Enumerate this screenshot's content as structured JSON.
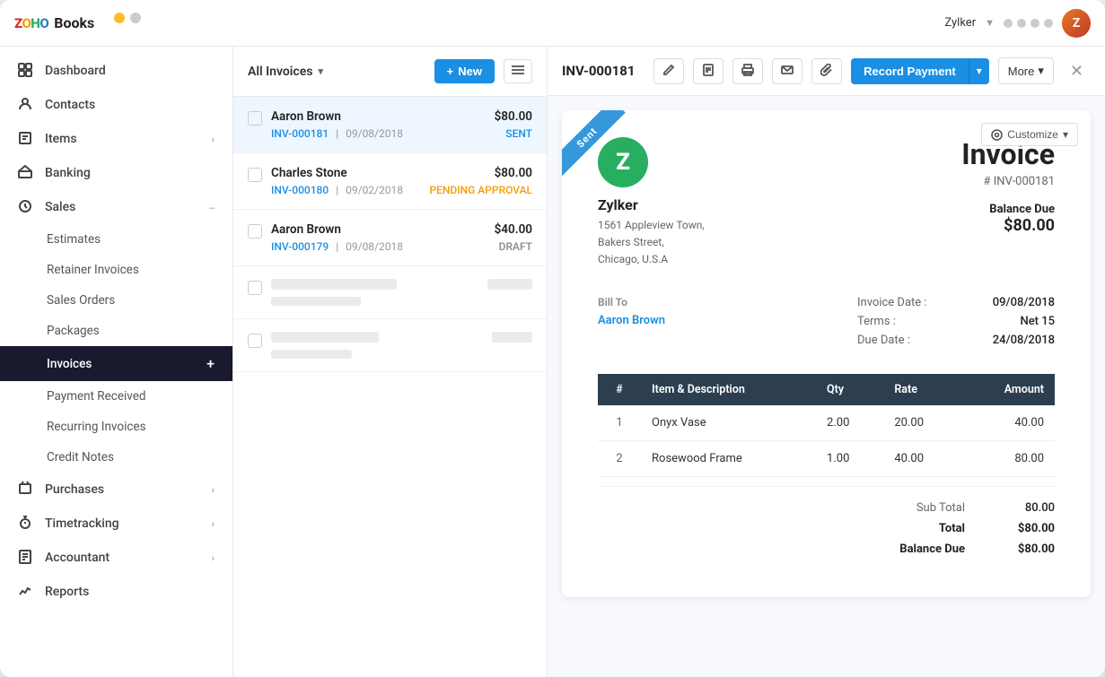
{
  "app": {
    "name": "Books",
    "brand": "ZOHO",
    "user": "Zylker",
    "user_avatar_text": "Z"
  },
  "sidebar": {
    "items": [
      {
        "id": "dashboard",
        "label": "Dashboard",
        "icon": "dashboard-icon",
        "has_children": false
      },
      {
        "id": "contacts",
        "label": "Contacts",
        "icon": "contacts-icon",
        "has_children": false
      },
      {
        "id": "items",
        "label": "Items",
        "icon": "items-icon",
        "has_children": true
      },
      {
        "id": "banking",
        "label": "Banking",
        "icon": "banking-icon",
        "has_children": false
      },
      {
        "id": "sales",
        "label": "Sales",
        "icon": "sales-icon",
        "has_children": true,
        "expanded": true
      }
    ],
    "sales_sub_items": [
      {
        "id": "estimates",
        "label": "Estimates"
      },
      {
        "id": "retainer-invoices",
        "label": "Retainer Invoices"
      },
      {
        "id": "sales-orders",
        "label": "Sales Orders"
      },
      {
        "id": "packages",
        "label": "Packages"
      },
      {
        "id": "invoices",
        "label": "Invoices",
        "active": true
      },
      {
        "id": "payment-received",
        "label": "Payment Received"
      },
      {
        "id": "recurring-invoices",
        "label": "Recurring Invoices"
      },
      {
        "id": "credit-notes",
        "label": "Credit Notes"
      }
    ],
    "bottom_items": [
      {
        "id": "purchases",
        "label": "Purchases",
        "icon": "purchases-icon",
        "has_children": true
      },
      {
        "id": "timetracking",
        "label": "Timetracking",
        "icon": "timetracking-icon",
        "has_children": true
      },
      {
        "id": "accountant",
        "label": "Accountant",
        "icon": "accountant-icon",
        "has_children": true
      },
      {
        "id": "reports",
        "label": "Reports",
        "icon": "reports-icon",
        "has_children": false
      }
    ]
  },
  "invoice_list": {
    "filter_label": "All Invoices",
    "new_button": "New",
    "invoices": [
      {
        "id": "inv1",
        "customer": "Aaron Brown",
        "number": "INV-000181",
        "date": "09/08/2018",
        "amount": "$80.00",
        "status": "SENT",
        "status_class": "status-sent",
        "selected": true
      },
      {
        "id": "inv2",
        "customer": "Charles Stone",
        "number": "INV-000180",
        "date": "09/02/2018",
        "amount": "$80.00",
        "status": "PENDING APPROVAL",
        "status_class": "status-pending",
        "selected": false
      },
      {
        "id": "inv3",
        "customer": "Aaron Brown",
        "number": "INV-000179",
        "date": "09/08/2018",
        "amount": "$40.00",
        "status": "DRAFT",
        "status_class": "status-draft",
        "selected": false
      }
    ]
  },
  "invoice_detail": {
    "invoice_id": "INV-000181",
    "record_payment_label": "Record Payment",
    "more_label": "More",
    "sent_ribbon": "Sent",
    "customize_label": "Customize",
    "company": {
      "name": "Zylker",
      "address_line1": "1561 Appleview Town,",
      "address_line2": "Bakers Street,",
      "address_line3": "Chicago, U.S.A",
      "logo_letter": "Z"
    },
    "invoice_title": "Invoice",
    "invoice_number": "# INV-000181",
    "balance_due_label": "Balance Due",
    "balance_due_amount": "$80.00",
    "bill_to_label": "Bill To",
    "bill_to_name": "Aaron Brown",
    "meta": {
      "invoice_date_label": "Invoice Date :",
      "invoice_date_value": "09/08/2018",
      "terms_label": "Terms :",
      "terms_value": "Net 15",
      "due_date_label": "Due Date :",
      "due_date_value": "24/08/2018"
    },
    "table": {
      "headers": [
        "#",
        "Item & Description",
        "Qty",
        "Rate",
        "Amount"
      ],
      "rows": [
        {
          "num": "1",
          "description": "Onyx Vase",
          "qty": "2.00",
          "rate": "20.00",
          "amount": "40.00"
        },
        {
          "num": "2",
          "description": "Rosewood Frame",
          "qty": "1.00",
          "rate": "40.00",
          "amount": "80.00"
        }
      ]
    },
    "totals": {
      "sub_total_label": "Sub Total",
      "sub_total_value": "80.00",
      "total_label": "Total",
      "total_value": "$80.00",
      "balance_due_label": "Balance Due",
      "balance_due_value": "$80.00"
    }
  }
}
